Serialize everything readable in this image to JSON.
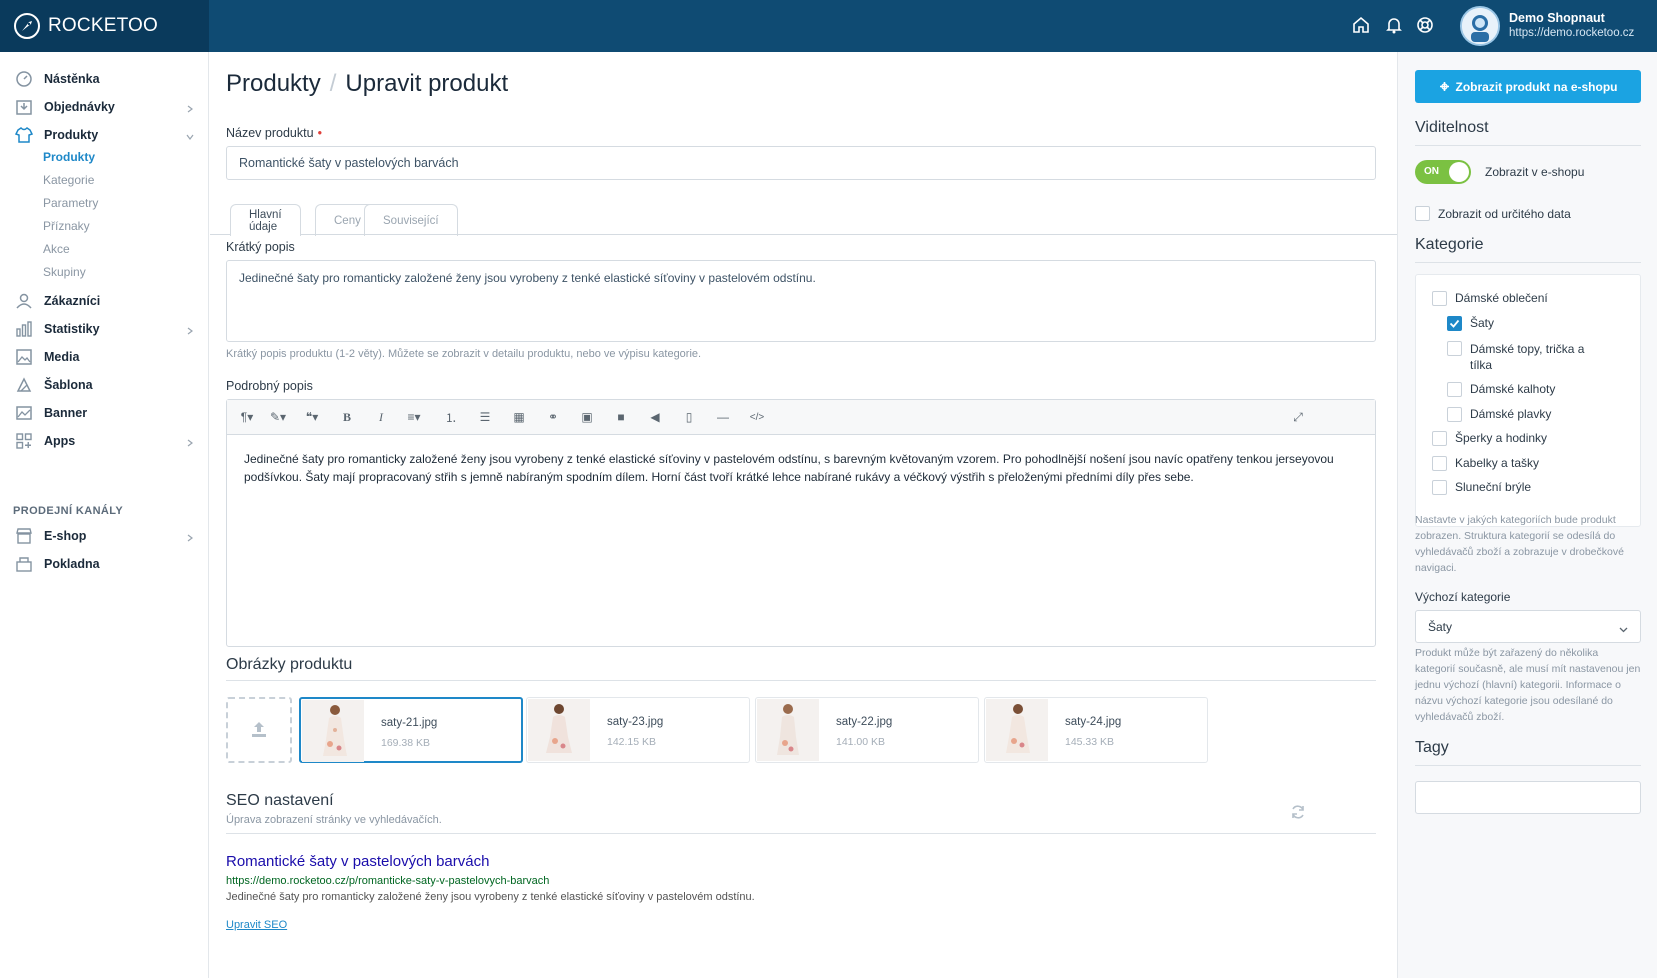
{
  "app": {
    "logo_text": "ROCKETOO"
  },
  "user": {
    "name": "Demo Shopnaut",
    "url": "https://demo.rocketoo.cz"
  },
  "sidebar": {
    "items": [
      {
        "label": "Nástěnka",
        "icon": "dashboard-icon"
      },
      {
        "label": "Objednávky",
        "icon": "orders-icon"
      },
      {
        "label": "Produkty",
        "icon": "shirt-icon"
      },
      {
        "label": "Zákazníci",
        "icon": "user-icon"
      },
      {
        "label": "Statistiky",
        "icon": "chart-icon"
      },
      {
        "label": "Media",
        "icon": "image-icon"
      },
      {
        "label": "Šablona",
        "icon": "template-icon"
      },
      {
        "label": "Banner",
        "icon": "banner-icon"
      },
      {
        "label": "Apps",
        "icon": "apps-icon"
      }
    ],
    "sub_items": [
      "Produkty",
      "Kategorie",
      "Parametry",
      "Příznaky",
      "Akce",
      "Skupiny"
    ],
    "section_title": "PRODEJNÍ KANÁLY",
    "channels": [
      {
        "label": "E-shop",
        "icon": "shop-icon"
      },
      {
        "label": "Pokladna",
        "icon": "register-icon"
      }
    ]
  },
  "main": {
    "breadcrumb": {
      "parent": "Produkty",
      "separator": "/",
      "current": "Upravit produkt"
    },
    "name_label": "Název produktu",
    "name_required": "•",
    "name_value": "Romantické šaty v pastelových barvách",
    "tabs": [
      "Hlavní údaje",
      "Ceny",
      "Související"
    ],
    "short_desc_label": "Krátký popis",
    "short_desc_value": "Jedinečné šaty pro romanticky založené ženy jsou vyrobeny z tenké elastické síťoviny v pastelovém odstínu.",
    "short_desc_help": "Krátký popis produktu (1-2 věty). Můžete se zobrazit v detailu produktu, nebo ve výpisu kategorie.",
    "long_desc_label": "Podrobný popis",
    "long_desc_value": "Jedinečné šaty pro romanticky založené ženy jsou vyrobeny z tenké elastické síťoviny v pastelovém odstínu, s barevným květovaným vzorem. Pro pohodlnější nošení jsou navíc opatřeny tenkou jerseyovou podšívkou. Šaty mají propracovaný střih s jemně nabíraným spodním dílem. Horní část tvoří krátké lehce nabírané rukávy a véčkový výstřih s přeloženými předními díly přes sebe.",
    "images_title": "Obrázky produktu",
    "images": [
      {
        "name": "saty-21.jpg",
        "size": "169.38 KB"
      },
      {
        "name": "saty-23.jpg",
        "size": "142.15 KB"
      },
      {
        "name": "saty-22.jpg",
        "size": "141.00 KB"
      },
      {
        "name": "saty-24.jpg",
        "size": "145.33 KB"
      }
    ],
    "seo_title": "SEO nastavení",
    "seo_help": "Úprava zobrazení stránky ve vyhledávačích.",
    "seo_preview_title": "Romantické šaty v pastelových barvách",
    "seo_preview_url": "https://demo.rocketoo.cz/p/romanticke-saty-v-pastelovych-barvach",
    "seo_preview_desc": "Jedinečné šaty pro romanticky založené ženy jsou vyrobeny z tenké elastické síťoviny v pastelovém odstínu.",
    "seo_edit_link": "Upravit SEO"
  },
  "right": {
    "show_button": "Zobrazit produkt na e-shopu",
    "visibility_title": "Viditelnost",
    "toggle_label": "ON",
    "toggle_text": "Zobrazit v e-shopu",
    "date_label": "Zobrazit od určitého data",
    "categories_title": "Kategorie",
    "categories": [
      {
        "label": "Dámské oblečení",
        "checked": false
      },
      {
        "label": "Šaty",
        "checked": true
      },
      {
        "label": "Dámské topy, trička a tílka",
        "checked": false
      },
      {
        "label": "Dámské kalhoty",
        "checked": false
      },
      {
        "label": "Dámské plavky",
        "checked": false
      },
      {
        "label": "Šperky a hodinky",
        "checked": false
      },
      {
        "label": "Kabelky a tašky",
        "checked": false
      },
      {
        "label": "Sluneční brýle",
        "checked": false
      }
    ],
    "categories_help": "Nastavte v jakých kategoriích bude produkt zobrazen. Struktura kategorií se odesílá do vyhledávačů zboží a zobrazuje v drobečkové navigaci.",
    "default_cat_label": "Výchozí kategorie",
    "default_cat_value": "Šaty",
    "default_cat_help": "Produkt může být zařazený do několika kategorií současně, ale musí mít nastavenou jen jednu výchozí (hlavní) kategorii. Informace o názvu výchozí kategorie jsou odesílané do vyhledávačů zboží.",
    "tags_title": "Tagy"
  },
  "colors": {
    "topbar": "#0f4b73",
    "accent": "#1ba3e2",
    "toggle_on": "#7bc142"
  }
}
